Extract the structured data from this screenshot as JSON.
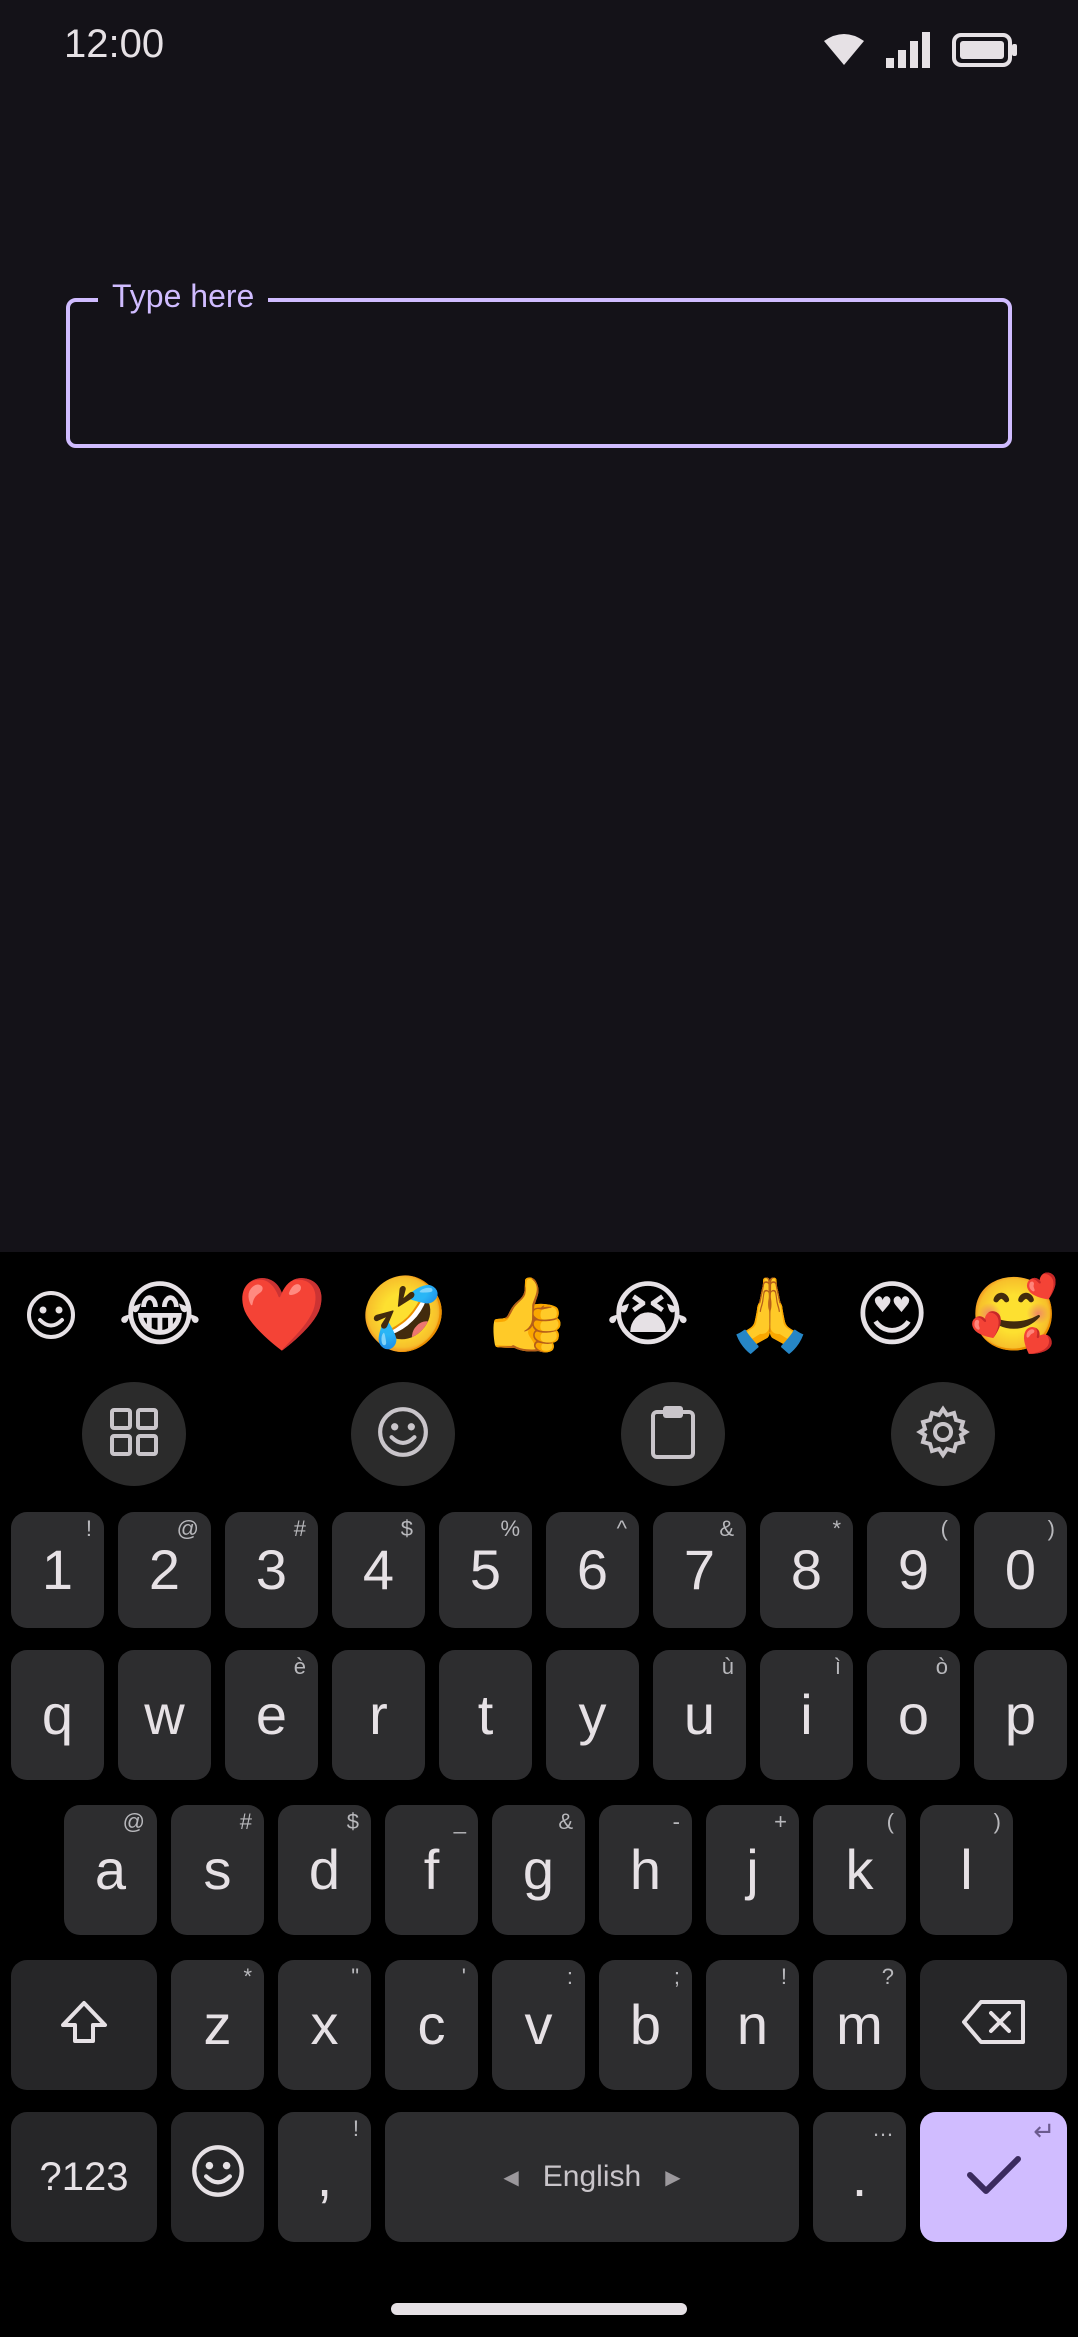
{
  "status": {
    "time": "12:00",
    "icons": [
      "wifi-icon",
      "cellular-signal-icon",
      "battery-icon"
    ]
  },
  "field": {
    "label": "Type here",
    "value": ""
  },
  "keyboard": {
    "emoji_suggestions": [
      "😂",
      "❤️",
      "🤣",
      "👍",
      "😭",
      "🙏",
      "😍",
      "🥰"
    ],
    "toolbar": [
      "apps-grid-icon",
      "emoji-icon",
      "clipboard-icon",
      "settings-gear-icon"
    ],
    "number_row": [
      {
        "key": "1",
        "hint": "!"
      },
      {
        "key": "2",
        "hint": "@"
      },
      {
        "key": "3",
        "hint": "#"
      },
      {
        "key": "4",
        "hint": "$"
      },
      {
        "key": "5",
        "hint": "%"
      },
      {
        "key": "6",
        "hint": "^"
      },
      {
        "key": "7",
        "hint": "&"
      },
      {
        "key": "8",
        "hint": "*"
      },
      {
        "key": "9",
        "hint": "("
      },
      {
        "key": "0",
        "hint": ")"
      }
    ],
    "row1": [
      {
        "key": "q",
        "hint": ""
      },
      {
        "key": "w",
        "hint": ""
      },
      {
        "key": "e",
        "hint": "è"
      },
      {
        "key": "r",
        "hint": ""
      },
      {
        "key": "t",
        "hint": ""
      },
      {
        "key": "y",
        "hint": ""
      },
      {
        "key": "u",
        "hint": "ù"
      },
      {
        "key": "i",
        "hint": "ì"
      },
      {
        "key": "o",
        "hint": "ò"
      },
      {
        "key": "p",
        "hint": ""
      }
    ],
    "row2": [
      {
        "key": "a",
        "hint": "@"
      },
      {
        "key": "s",
        "hint": "#"
      },
      {
        "key": "d",
        "hint": "$"
      },
      {
        "key": "f",
        "hint": "_"
      },
      {
        "key": "g",
        "hint": "&"
      },
      {
        "key": "h",
        "hint": "-"
      },
      {
        "key": "j",
        "hint": "+"
      },
      {
        "key": "k",
        "hint": "("
      },
      {
        "key": "l",
        "hint": ")"
      }
    ],
    "row3": [
      {
        "key": "z",
        "hint": "*"
      },
      {
        "key": "x",
        "hint": "\""
      },
      {
        "key": "c",
        "hint": "'"
      },
      {
        "key": "v",
        "hint": ":"
      },
      {
        "key": "b",
        "hint": ";"
      },
      {
        "key": "n",
        "hint": "!"
      },
      {
        "key": "m",
        "hint": "?"
      }
    ],
    "bottom": {
      "symbols_label": "?123",
      "comma": ",",
      "comma_hint": "!",
      "space_label": "English",
      "period": ".",
      "period_hint": "…",
      "enter_hint": "↵"
    },
    "colors": {
      "accent": "#d0bcff",
      "key_bg": "#2d2d2f",
      "keyboard_bg": "#000000",
      "app_bg": "#141218"
    }
  }
}
